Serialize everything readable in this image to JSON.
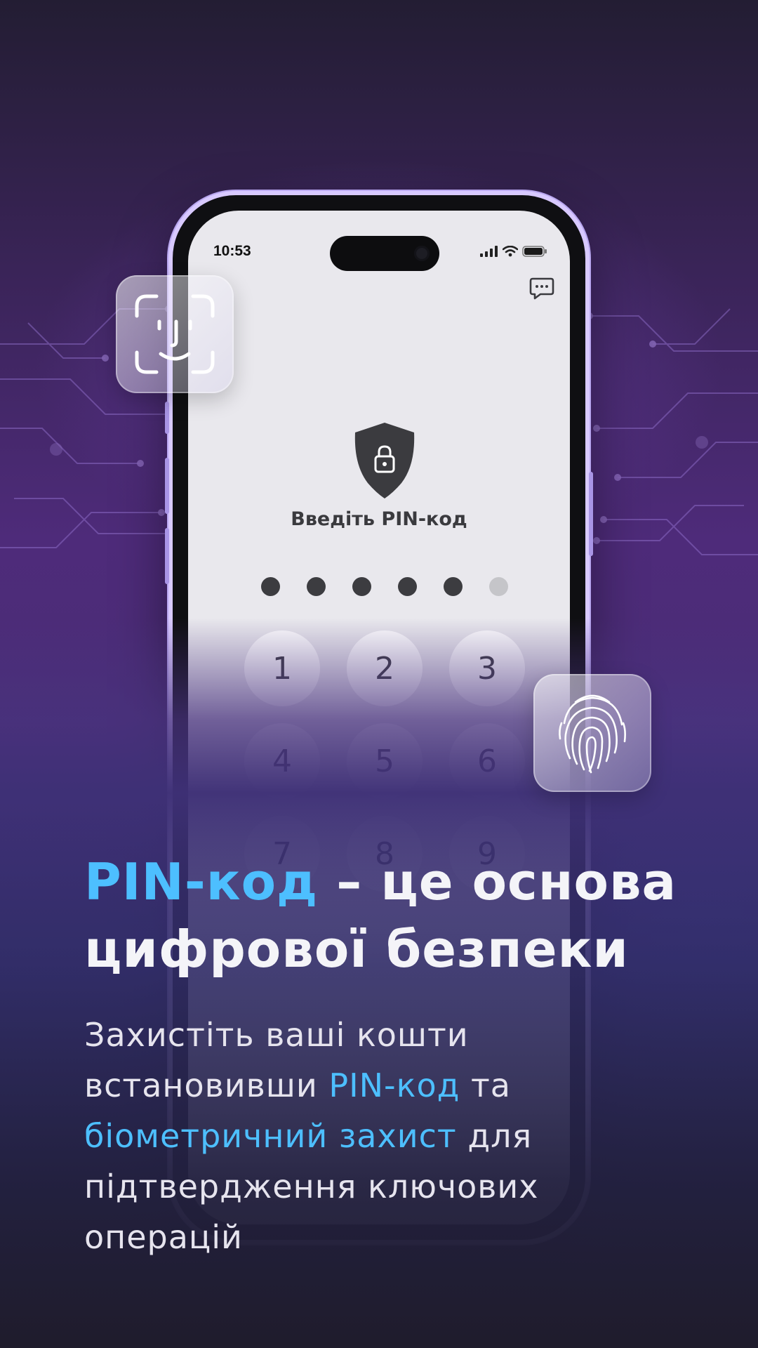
{
  "status_bar": {
    "time": "10:53"
  },
  "lock_screen": {
    "title": "Введіть PIN-код",
    "pin_dots": {
      "filled": 5,
      "total": 6
    },
    "keys": [
      "1",
      "2",
      "3",
      "4",
      "5",
      "6",
      "7",
      "8",
      "9"
    ]
  },
  "icons": {
    "chat": "chat-bubble-icon",
    "shield": "shield-lock-icon",
    "face_id": "face-id-icon",
    "fingerprint": "fingerprint-icon"
  },
  "headline": {
    "accent": "PIN-код",
    "rest_line1": " – це основа",
    "line2": "цифрової безпеки"
  },
  "description": {
    "part1": "Захистіть ваші кошти встановивши ",
    "accent1": "PIN-код",
    "part2": " та ",
    "accent2": "біометричний захист",
    "part3": " для підтвердження ключових операцій"
  },
  "colors": {
    "accent": "#4dbfff",
    "background_top": "#231d33",
    "background_mid": "#4e2b7a",
    "phone_frame": "#d8c9ff"
  }
}
